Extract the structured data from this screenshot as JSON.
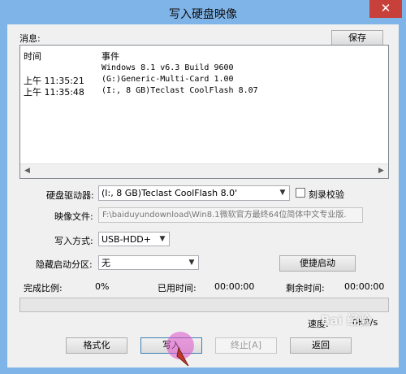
{
  "window": {
    "title": "写入硬盘映像",
    "close_glyph": "✕"
  },
  "log": {
    "label": "消息:",
    "save_label": "保存",
    "columns": [
      "时间",
      "事件"
    ],
    "rows": [
      {
        "time": "",
        "event": "Windows 8.1 v6.3 Build 9600"
      },
      {
        "time": "上午 11:35:21",
        "event": "(G:)Generic-Multi-Card       1.00"
      },
      {
        "time": "上午 11:35:48",
        "event": "(I:, 8 GB)Teclast CoolFlash       8.07"
      }
    ]
  },
  "drive": {
    "label": "硬盘驱动器:",
    "value": "(I:, 8 GB)Teclast CoolFlash       8.0'",
    "verify_label": "刻录校验",
    "verify_checked": false
  },
  "image_file": {
    "label": "映像文件:",
    "value": "F:\\baiduyundownload\\Win8.1微软官方最终64位简体中文专业版."
  },
  "write_method": {
    "label": "写入方式:",
    "value": "USB-HDD+"
  },
  "hidden_partition": {
    "label": "隐藏启动分区:",
    "value": "无"
  },
  "quick_boot_label": "便捷启动",
  "status": {
    "completion_label": "完成比例:",
    "completion_value": "0%",
    "elapsed_label": "已用时间:",
    "elapsed_value": "00:00:00",
    "remaining_label": "剩余时间:",
    "remaining_value": "00:00:00",
    "speed_label": "速度:",
    "speed_value": "0KB/s",
    "progress_fraction": 0
  },
  "buttons": {
    "format": "格式化",
    "write": "写入",
    "stop": "终止[A]",
    "back": "返回"
  },
  "watermark": "Bai 经验"
}
